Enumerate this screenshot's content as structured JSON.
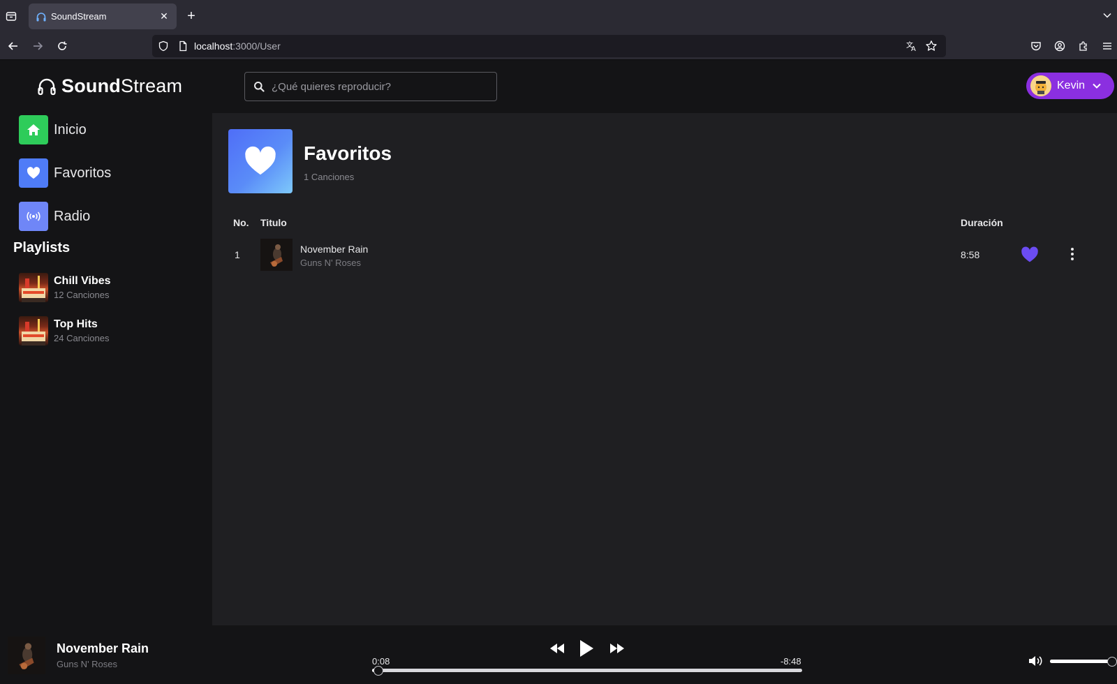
{
  "browser": {
    "tab_title": "SoundStream",
    "url_host": "localhost",
    "url_path": ":3000/User"
  },
  "app": {
    "logo_bold": "Sound",
    "logo_light": "Stream",
    "accent_color": "#8b2fe0"
  },
  "sidebar": {
    "items": [
      {
        "label": "Inicio",
        "icon": "home-icon",
        "color": "#2ecc5a"
      },
      {
        "label": "Favoritos",
        "icon": "heart-icon",
        "color": "#4f7cf7"
      },
      {
        "label": "Radio",
        "icon": "radio-icon",
        "color": "#6f86f7"
      }
    ],
    "playlists_heading": "Playlists",
    "playlists": [
      {
        "name": "Chill Vibes",
        "count": "12 Canciones"
      },
      {
        "name": "Top Hits",
        "count": "24 Canciones"
      }
    ]
  },
  "header": {
    "search_placeholder": "¿Qué quieres reproducir?",
    "user_name": "Kevin"
  },
  "favorites": {
    "title": "Favoritos",
    "count": "1 Canciones",
    "columns": {
      "no": "No.",
      "title": "Titulo",
      "duration": "Duración"
    },
    "tracks": [
      {
        "no": "1",
        "title": "November Rain",
        "artist": "Guns N' Roses",
        "duration": "8:58",
        "liked": true
      }
    ]
  },
  "player": {
    "title": "November Rain",
    "artist": "Guns N' Roses",
    "current_time": "0:08",
    "remaining_time": "-8:48",
    "progress_fraction": 0.015,
    "volume_fraction": 1.0
  }
}
